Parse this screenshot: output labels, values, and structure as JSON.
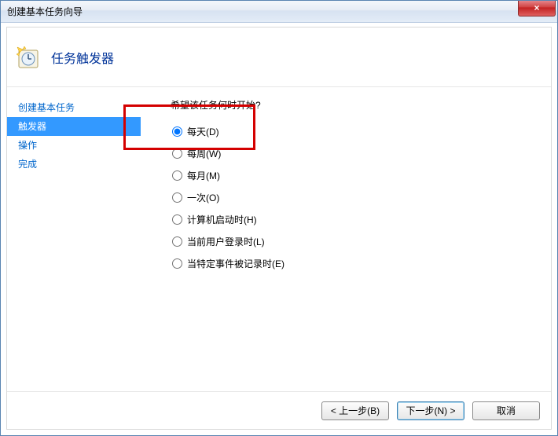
{
  "window": {
    "title": "创建基本任务向导",
    "close_label": "×"
  },
  "header": {
    "title": "任务触发器"
  },
  "sidebar": {
    "items": [
      {
        "label": "创建基本任务",
        "selected": false
      },
      {
        "label": "触发器",
        "selected": true
      },
      {
        "label": "操作",
        "selected": false
      },
      {
        "label": "完成",
        "selected": false
      }
    ]
  },
  "main": {
    "prompt": "希望该任务何时开始?",
    "options": [
      {
        "label": "每天(D)",
        "checked": true
      },
      {
        "label": "每周(W)",
        "checked": false
      },
      {
        "label": "每月(M)",
        "checked": false
      },
      {
        "label": "一次(O)",
        "checked": false
      },
      {
        "label": "计算机启动时(H)",
        "checked": false
      },
      {
        "label": "当前用户登录时(L)",
        "checked": false
      },
      {
        "label": "当特定事件被记录时(E)",
        "checked": false
      }
    ]
  },
  "footer": {
    "back": "< 上一步(B)",
    "next": "下一步(N) >",
    "cancel": "取消"
  }
}
